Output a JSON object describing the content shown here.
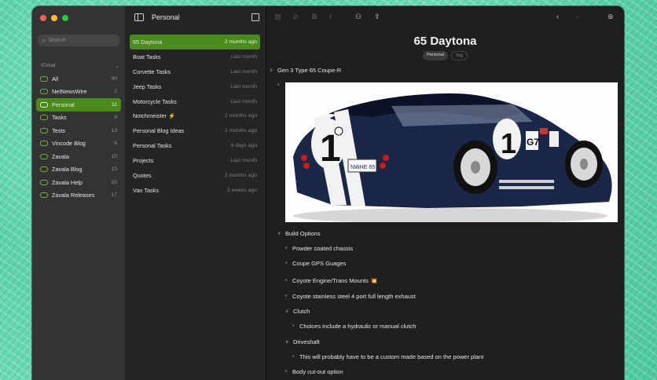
{
  "colors": {
    "accent": "#4a8a1e",
    "traffic": [
      "#ff5f57",
      "#febc2e",
      "#28c840"
    ]
  },
  "sidebar": {
    "search_placeholder": "Search",
    "section": "iCloud",
    "items": [
      {
        "label": "All",
        "count": "90"
      },
      {
        "label": "NetNewsWire",
        "count": "2"
      },
      {
        "label": "Personal",
        "count": "11",
        "selected": true
      },
      {
        "label": "Tasks",
        "count": "9"
      },
      {
        "label": "Tests",
        "count": "13"
      },
      {
        "label": "Vincode Blog",
        "count": "6"
      },
      {
        "label": "Zavala",
        "count": "10"
      },
      {
        "label": "Zavala Blog",
        "count": "15"
      },
      {
        "label": "Zavala Help",
        "count": "20"
      },
      {
        "label": "Zavala Releases",
        "count": "17"
      }
    ]
  },
  "list": {
    "title": "Personal",
    "docs": [
      {
        "name": "65 Daytona",
        "date": "2 months ago",
        "selected": true
      },
      {
        "name": "Boat Tasks",
        "date": "Last month"
      },
      {
        "name": "Corvette Tasks",
        "date": "Last month"
      },
      {
        "name": "Jeep Tasks",
        "date": "Last month"
      },
      {
        "name": "Motorcycle Tasks",
        "date": "Last month"
      },
      {
        "name": "Notchmeister ⚡",
        "date": "2 months ago"
      },
      {
        "name": "Personal Blog Ideas",
        "date": "2 months ago"
      },
      {
        "name": "Personal Tasks",
        "date": "6 days ago"
      },
      {
        "name": "Projects",
        "date": "Last month"
      },
      {
        "name": "Quotes",
        "date": "2 months ago"
      },
      {
        "name": "Van Tasks",
        "date": "3 weeks ago"
      }
    ]
  },
  "editor": {
    "title": "65 Daytona",
    "tags": [
      "Personal",
      "Tag"
    ],
    "toolbar_icons": [
      "image-icon",
      "link-icon",
      "bold-icon",
      "italic-icon",
      "share-group-icon",
      "share-icon",
      "back-icon",
      "forward-icon",
      "filter-icon"
    ],
    "rows": {
      "heading": "Gen 3 Type 65 Coupe-R",
      "build_options": "Build Options",
      "powder": "Powder coated chassis",
      "gps": "Coupe GPS Guages",
      "coyote": "Coyote Engine/Trans Mounts 💥",
      "exhaust": "Coyote stainless steel 4 port full length exhaust",
      "clutch": "Clutch",
      "clutch_note": "Choices include a hydraulic or manual clutch",
      "driveshaft": "Driveshaft",
      "driveshaft_note": "This will probably have to be a custom made based on the power plant",
      "body": "Body cut-out option"
    },
    "car": {
      "number": "1",
      "plate": "NWHE 65",
      "badge": "G7"
    }
  }
}
